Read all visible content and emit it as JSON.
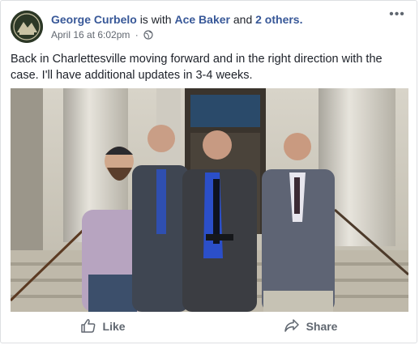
{
  "post": {
    "author": "George Curbelo",
    "with_text": "is with",
    "tagged_person": "Ace Baker",
    "and_text": "and",
    "others_link": "2 others.",
    "date": "April 16 at 6:02pm",
    "separator": "·",
    "audience_icon": "globe-icon",
    "more_label": "•••",
    "text": "Back in Charlettesville moving forward and in the right direction with the case. I'll have additional updates in 3-4 weeks."
  },
  "actions": {
    "like_label": "Like",
    "share_label": "Share",
    "like_icon": "thumbs-up-icon",
    "share_icon": "share-arrow-icon"
  },
  "colors": {
    "link": "#385898",
    "meta": "#616770",
    "action": "#606770",
    "border": "#dddfe2"
  }
}
